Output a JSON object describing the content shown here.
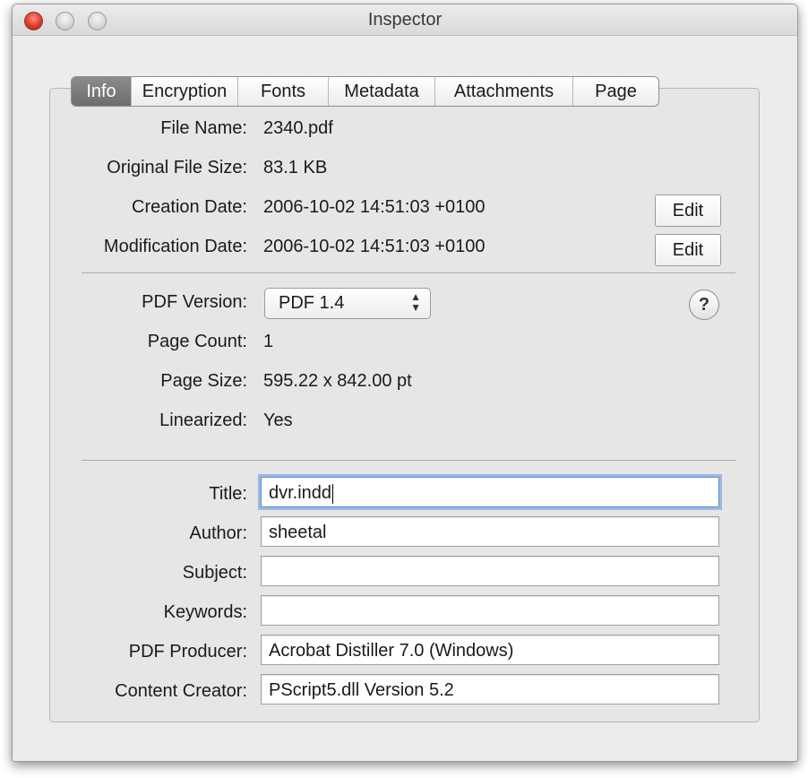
{
  "window": {
    "title": "Inspector"
  },
  "tabs": [
    "Info",
    "Encryption",
    "Fonts",
    "Metadata",
    "Attachments",
    "Page"
  ],
  "active_tab": "Info",
  "file_info": {
    "file_name_label": "File Name:",
    "file_name": "2340.pdf",
    "original_size_label": "Original File Size:",
    "original_size": "83.1 KB",
    "creation_label": "Creation Date:",
    "creation_date": "2006-10-02 14:51:03 +0100",
    "modification_label": "Modification Date:",
    "modification_date": "2006-10-02 14:51:03 +0100",
    "edit_label": "Edit"
  },
  "pdf": {
    "version_label": "PDF Version:",
    "version_value": "PDF 1.4",
    "page_count_label": "Page Count:",
    "page_count": "1",
    "page_size_label": "Page Size:",
    "page_size": "595.22 x 842.00 pt",
    "linearized_label": "Linearized:",
    "linearized": "Yes",
    "help": "?"
  },
  "metadata": {
    "title_label": "Title:",
    "title": "dvr.indd",
    "author_label": "Author:",
    "author": "sheetal",
    "subject_label": "Subject:",
    "subject": "",
    "keywords_label": "Keywords:",
    "keywords": "",
    "producer_label": "PDF Producer:",
    "producer": "Acrobat Distiller 7.0 (Windows)",
    "creator_label": "Content Creator:",
    "creator": "PScript5.dll Version 5.2"
  },
  "colors": {
    "focus_ring": "#5d8fd4",
    "active_tab": "#7a7a7a",
    "close_button": "#e0382c"
  },
  "icons": {
    "popup_arrows": "up-down-chevron-icon"
  }
}
